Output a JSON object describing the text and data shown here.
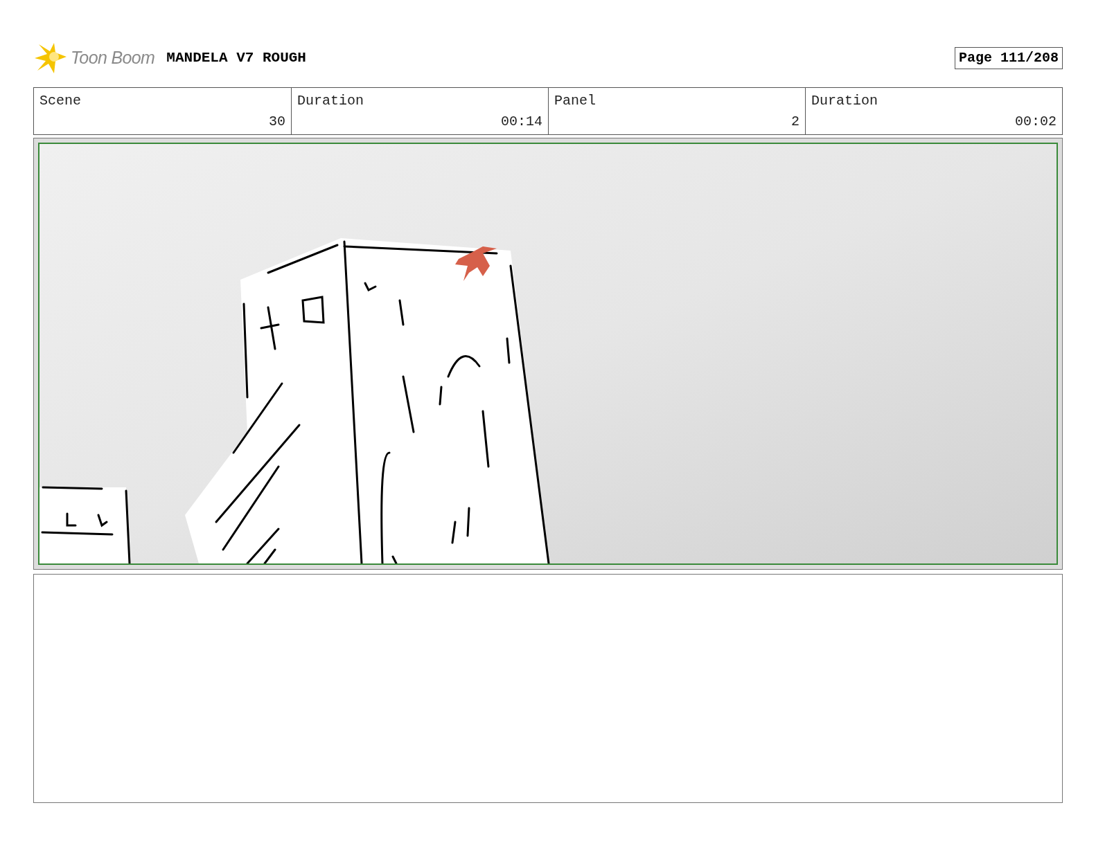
{
  "header": {
    "logo_text": "Toon Boom",
    "project_title": "MANDELA V7 ROUGH",
    "page": "Page 111/208"
  },
  "info_table": {
    "labels": [
      "Scene",
      "Duration",
      "Panel",
      "Duration"
    ],
    "values": [
      "30",
      "00:14",
      "2",
      "00:02"
    ]
  }
}
